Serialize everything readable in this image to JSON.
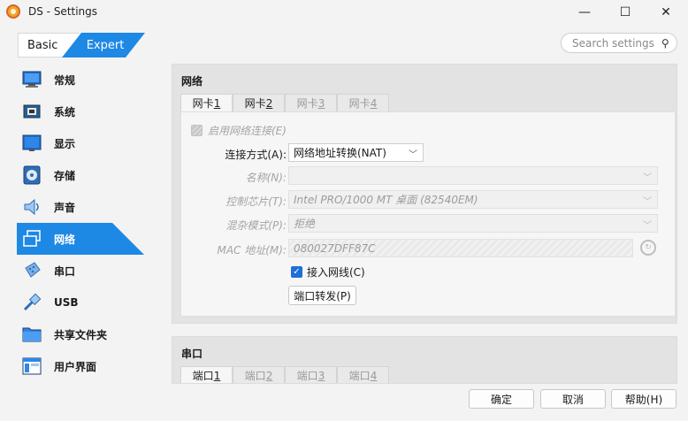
{
  "window": {
    "title": "DS - Settings",
    "minimize": "—",
    "maximize": "☐",
    "close": "✕"
  },
  "mode": {
    "basic": "Basic",
    "expert": "Expert"
  },
  "search": {
    "placeholder": "Search settings"
  },
  "sidebar": {
    "items": [
      {
        "label": "常规",
        "icon": "general-icon"
      },
      {
        "label": "系统",
        "icon": "system-icon"
      },
      {
        "label": "显示",
        "icon": "display-icon"
      },
      {
        "label": "存储",
        "icon": "storage-icon"
      },
      {
        "label": "声音",
        "icon": "audio-icon"
      },
      {
        "label": "网络",
        "icon": "network-icon",
        "active": true
      },
      {
        "label": "串口",
        "icon": "serial-icon"
      },
      {
        "label": "USB",
        "icon": "usb-icon"
      },
      {
        "label": "共享文件夹",
        "icon": "shared-folder-icon"
      },
      {
        "label": "用户界面",
        "icon": "user-interface-icon"
      }
    ]
  },
  "network": {
    "title": "网络",
    "tabs": [
      {
        "prefix": "网卡 ",
        "num": "1"
      },
      {
        "prefix": "网卡 ",
        "num": "2"
      },
      {
        "prefix": "网卡 ",
        "num": "3"
      },
      {
        "prefix": "网卡 ",
        "num": "4"
      }
    ],
    "enable_label": "启用网络连接(E)",
    "attached_label": "连接方式(A):",
    "attached_value": "网络地址转换(NAT)",
    "name_label": "名称(N):",
    "name_value": "",
    "adapter_label": "控制芯片(T):",
    "adapter_value": "Intel PRO/1000 MT 桌面 (82540EM)",
    "promisc_label": "混杂模式(P):",
    "promisc_value": "拒绝",
    "mac_label": "MAC 地址(M):",
    "mac_value": "080027DFF87C",
    "cable_label": "接入网线(C)",
    "port_forward_label": "端口转发(P)"
  },
  "serial": {
    "title": "串口",
    "tabs": [
      {
        "prefix": "端口 ",
        "num": "1"
      },
      {
        "prefix": "端口 ",
        "num": "2"
      },
      {
        "prefix": "端口 ",
        "num": "3"
      },
      {
        "prefix": "端口 ",
        "num": "4"
      }
    ]
  },
  "footer": {
    "ok": "确定",
    "cancel": "取消",
    "help": "帮助(H)"
  },
  "colors": {
    "accent": "#1e88e5",
    "checkbox": "#1e6fd6"
  }
}
